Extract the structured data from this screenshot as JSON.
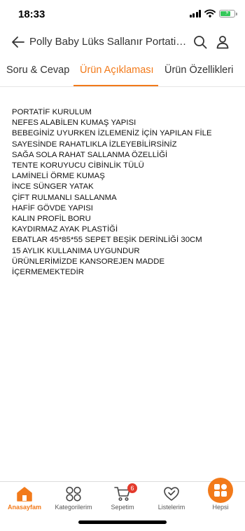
{
  "status_bar": {
    "time": "18:33",
    "battery_level": 0.75
  },
  "header": {
    "title": "Polly Baby Lüks Sallanır Portatif Beşik"
  },
  "tabs": [
    {
      "label": "Soru & Cevap",
      "active": false
    },
    {
      "label": "Ürün Açıklaması",
      "active": true
    },
    {
      "label": "Ürün Özellikleri",
      "active": false
    }
  ],
  "description": {
    "lines": [
      "PORTATİF KURULUM",
      "NEFES ALABİLEN KUMAŞ YAPISI",
      "BEBEGİNİZ UYURKEN İZLEMENİZ İÇİN YAPILAN FİLE",
      "SAYESİNDE RAHATLIKLA İZLEYEBİLİRSİNİZ",
      "SAĞA SOLA RAHAT SALLANMA ÖZELLİĞİ",
      "TENTE KORUYUCU CİBİNLİK TÜLÜ",
      "LAMİNELİ ÖRME KUMAŞ",
      "İNCE SÜNGER YATAK",
      "ÇİFT RULMANLI SALLANMA",
      "HAFİF GÖVDE YAPISI",
      "KALIN PROFİL BORU",
      "KAYDIRMAZ AYAK PLASTİĞİ",
      "EBATLAR 45*85*55 SEPET BEŞİK DERİNLİĞİ 30CM",
      "15 AYLIK KULLANIMA UYGUNDUR",
      "ÜRÜNLERİMİZDE KANSOREJEN MADDE",
      "İÇERMEMEKTEDİR"
    ]
  },
  "bottom_nav": {
    "items": [
      {
        "label": "Anasayfam",
        "icon": "home-icon",
        "active": true
      },
      {
        "label": "Kategorilerim",
        "icon": "categories-icon",
        "active": false
      },
      {
        "label": "Sepetim",
        "icon": "cart-icon",
        "active": false,
        "badge": "6"
      },
      {
        "label": "Listelerim",
        "icon": "heart-list-icon",
        "active": false
      },
      {
        "label": "Hepsi",
        "icon": "all-apps-icon",
        "active": false
      }
    ]
  },
  "colors": {
    "accent": "#f27a1a",
    "badge": "#e33a2c",
    "text": "#111111"
  }
}
